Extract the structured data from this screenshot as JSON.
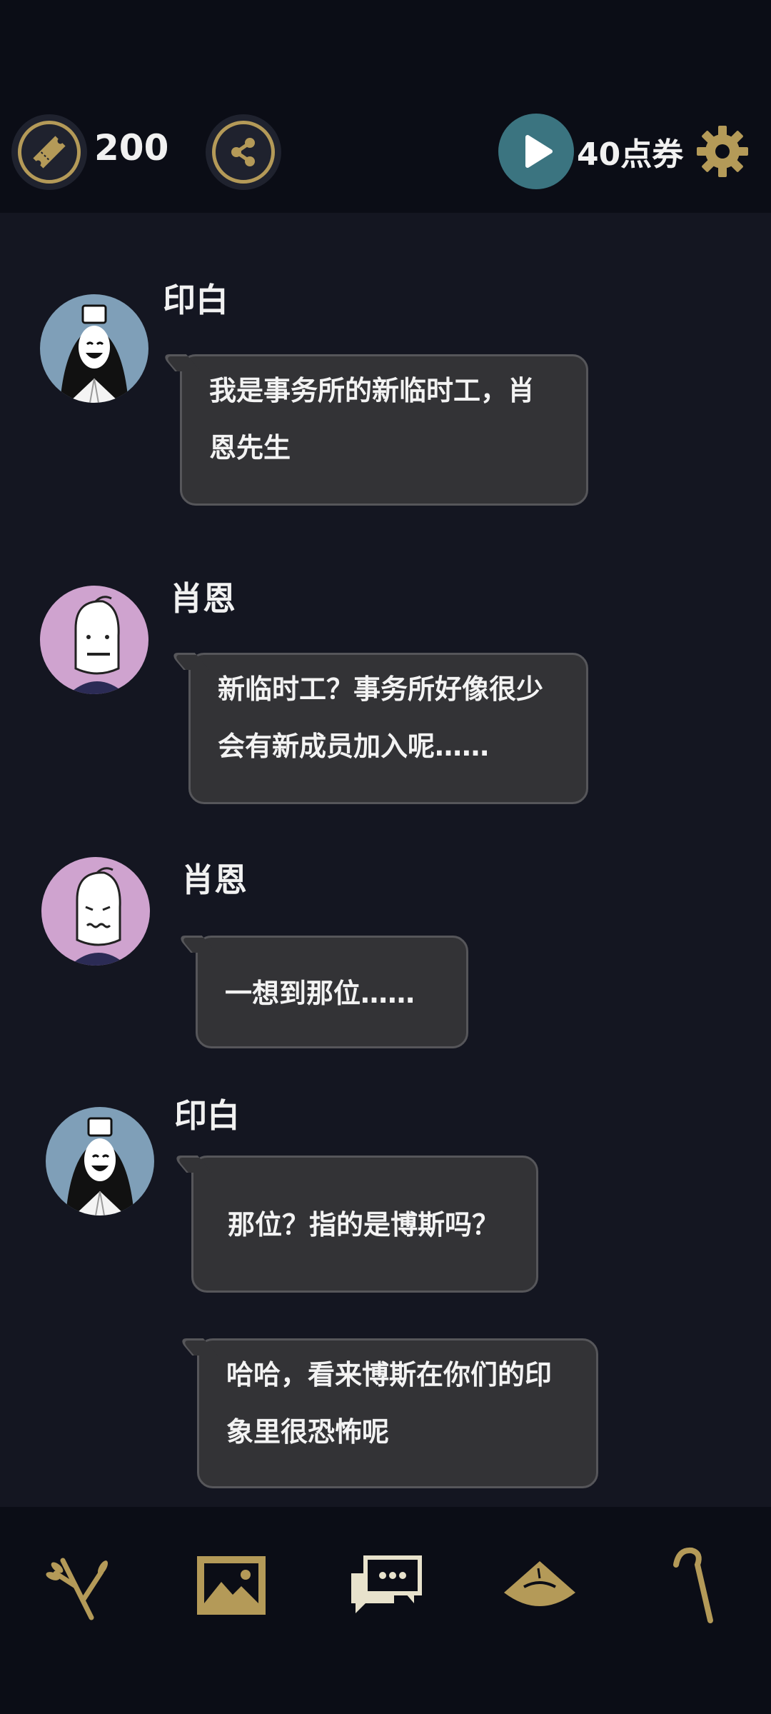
{
  "header": {
    "ticket_count": "200",
    "voucher_label": "40点券"
  },
  "icons": {
    "ticket": "ticket-icon",
    "share": "share-icon",
    "play": "play-icon",
    "settings": "gear-icon"
  },
  "messages": [
    {
      "speaker": "印白",
      "text_lines": [
        "我是事务所的新临时工，肖",
        "恩先生"
      ]
    },
    {
      "speaker": "肖恩",
      "text_lines": [
        "新临时工？事务所好像很少",
        "会有新成员加入呢……"
      ]
    },
    {
      "speaker": "肖恩",
      "text_lines": [
        "一想到那位……"
      ]
    },
    {
      "speaker": "印白",
      "text_lines": [
        "那位？指的是博斯吗？"
      ]
    },
    {
      "speaker": "",
      "text_lines": [
        "哈哈，看来博斯在你们的印",
        "象里很恐怖呢"
      ]
    }
  ],
  "nav": {
    "items": [
      {
        "icon": "branch-icon",
        "active": false
      },
      {
        "icon": "gallery-icon",
        "active": false
      },
      {
        "icon": "chat-icon",
        "active": true
      },
      {
        "icon": "hat-icon",
        "active": false
      },
      {
        "icon": "cane-icon",
        "active": false
      }
    ]
  },
  "colors": {
    "accent_gold": "#b49a58",
    "active_nav": "#e8e2cc",
    "background": "#0c0e16",
    "chat_bg": "#141621",
    "bubble_bg": "#333336",
    "play_button": "#3b7480"
  }
}
